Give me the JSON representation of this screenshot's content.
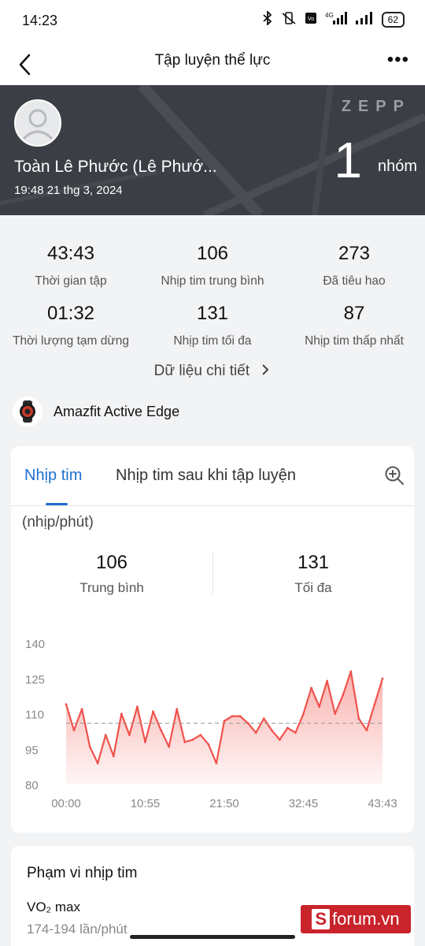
{
  "status": {
    "time": "14:23",
    "icons": [
      "bluetooth-icon",
      "vibrate-off-icon",
      "volte-icon",
      "signal-4g-icon",
      "signal-icon"
    ],
    "battery": "62",
    "network": "4G"
  },
  "nav": {
    "title": "Tập luyện thể lực",
    "more": "•••"
  },
  "banner": {
    "name": "Toàn Lê Phước (Lê Phướ...",
    "date": "19:48 21 thg 3, 2024",
    "brand": "ZEPP",
    "group_count": "1",
    "group_unit": "nhóm"
  },
  "stats": [
    {
      "value": "43:43",
      "label": "Thời gian tập"
    },
    {
      "value": "106",
      "label": "Nhịp tim trung bình"
    },
    {
      "value": "273",
      "label": "Đã tiêu hao"
    },
    {
      "value": "01:32",
      "label": "Thời lượng tạm dừng"
    },
    {
      "value": "131",
      "label": "Nhịp tim tối đa"
    },
    {
      "value": "87",
      "label": "Nhịp tim thấp nhất"
    }
  ],
  "detail_link": "Dữ liệu chi tiết",
  "device": {
    "name": "Amazfit Active Edge"
  },
  "hr_card": {
    "tabs": [
      "Nhịp tim",
      "Nhịp tim sau khi tập luyện"
    ],
    "active_tab": 0,
    "unit": "(nhịp/phút)",
    "avg_value": "106",
    "avg_label": "Trung bình",
    "max_value": "131",
    "max_label": "Tối đa"
  },
  "chart_data": {
    "type": "area",
    "color": "#f0524c",
    "average_line": 106,
    "ylim": [
      80,
      140
    ],
    "y_ticks": [
      "140",
      "125",
      "110",
      "95",
      "80"
    ],
    "x_ticks": [
      "00:00",
      "10:55",
      "21:50",
      "32:45",
      "43:43"
    ],
    "series": [
      {
        "x": [
          "00:00",
          "01:05",
          "02:11",
          "03:16",
          "04:22",
          "05:27",
          "06:33",
          "07:38",
          "08:44",
          "09:49",
          "10:55",
          "12:00",
          "13:06",
          "14:11",
          "15:17",
          "16:22",
          "17:28",
          "18:33",
          "19:39",
          "20:44",
          "21:50",
          "22:55",
          "24:01",
          "25:06",
          "26:12",
          "27:17",
          "28:23",
          "29:28",
          "30:34",
          "31:39",
          "32:45",
          "33:50",
          "34:56",
          "36:01",
          "37:07",
          "38:12",
          "39:18",
          "40:23",
          "41:29",
          "42:34",
          "43:43"
        ],
        "values": [
          114,
          103,
          112,
          96,
          89,
          101,
          92,
          110,
          101,
          113,
          98,
          111,
          103,
          96,
          112,
          98,
          99,
          101,
          97,
          89,
          107,
          109,
          109,
          106,
          102,
          108,
          103,
          99,
          104,
          102,
          110,
          121,
          113,
          124,
          110,
          118,
          128,
          108,
          103,
          114,
          125
        ]
      }
    ]
  },
  "zone_card": {
    "title": "Phạm vi nhịp tim",
    "vo2_label": "VO₂ max",
    "range": "174-194 lần/phút"
  },
  "watermark": "forum.vn"
}
